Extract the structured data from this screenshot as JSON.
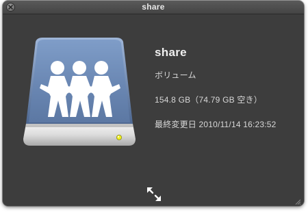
{
  "window": {
    "title": "share"
  },
  "item": {
    "name": "share",
    "kind": "ボリューム",
    "size": "154.8 GB（74.79 GB 空き）",
    "modified": "最終変更日 2010/11/14 16:23:52"
  },
  "icons": {
    "close": "close-icon",
    "drive": "shared-drive-icon",
    "fullscreen": "fullscreen-arrows-icon",
    "resize": "resize-grip-icon"
  },
  "colors": {
    "background": "#3d3d3d",
    "drive_face": "#6b87b3",
    "indicator": "#e6e61a"
  }
}
